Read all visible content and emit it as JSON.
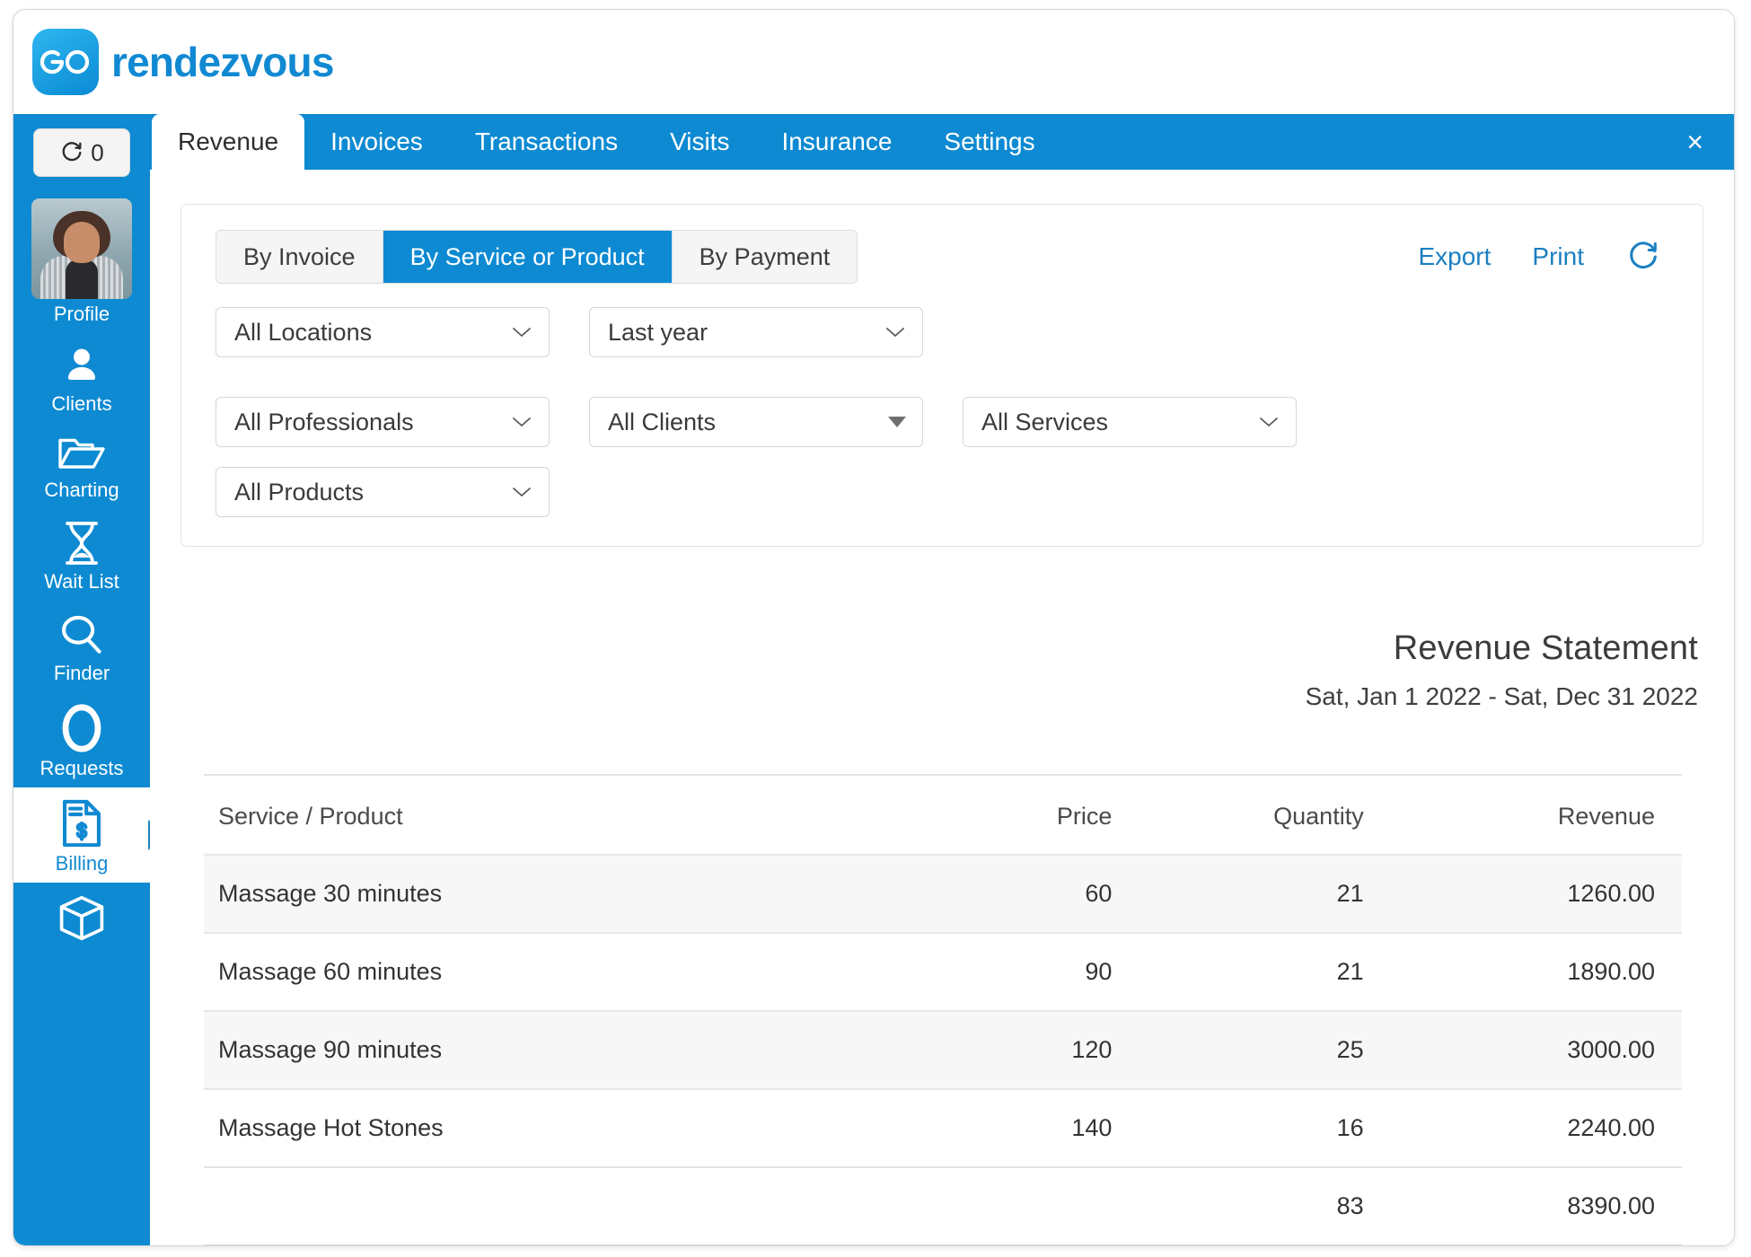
{
  "brand": {
    "logo_text": "GO",
    "name": "rendezvous",
    "logo_icon": "go-logo-icon",
    "accent_color": "#0d8ad2"
  },
  "sidebar": {
    "refresh": {
      "icon": "refresh-icon",
      "count": "0"
    },
    "items": [
      {
        "key": "profile",
        "label": "Profile",
        "icon": "avatar-photo",
        "active": false
      },
      {
        "key": "clients",
        "label": "Clients",
        "icon": "person-icon",
        "active": false
      },
      {
        "key": "charting",
        "label": "Charting",
        "icon": "folder-icon",
        "active": false
      },
      {
        "key": "waitlist",
        "label": "Wait List",
        "icon": "hourglass-icon",
        "active": false
      },
      {
        "key": "finder",
        "label": "Finder",
        "icon": "magnifier-icon",
        "active": false
      },
      {
        "key": "requests",
        "label": "Requests",
        "icon": "circle-icon",
        "active": false
      },
      {
        "key": "billing",
        "label": "Billing",
        "icon": "invoice-dollar-icon",
        "active": true
      },
      {
        "key": "inventory",
        "label": "",
        "icon": "box-cube-icon",
        "active": false
      }
    ]
  },
  "tabs": {
    "items": [
      {
        "label": "Revenue",
        "active": true
      },
      {
        "label": "Invoices",
        "active": false
      },
      {
        "label": "Transactions",
        "active": false
      },
      {
        "label": "Visits",
        "active": false
      },
      {
        "label": "Insurance",
        "active": false
      },
      {
        "label": "Settings",
        "active": false
      }
    ],
    "close_label": "×"
  },
  "toolbar": {
    "segments": [
      {
        "label": "By Invoice",
        "active": false
      },
      {
        "label": "By Service or Product",
        "active": true
      },
      {
        "label": "By Payment",
        "active": false
      }
    ],
    "export_label": "Export",
    "print_label": "Print",
    "refresh_icon": "refresh-icon"
  },
  "filters": [
    {
      "name": "locations",
      "value": "All Locations",
      "arrow": "chevron"
    },
    {
      "name": "period",
      "value": "Last year",
      "arrow": "chevron"
    },
    {
      "name": "professionals",
      "value": "All Professionals",
      "arrow": "chevron"
    },
    {
      "name": "clients",
      "value": "All Clients",
      "arrow": "triangle"
    },
    {
      "name": "services",
      "value": "All Services",
      "arrow": "chevron"
    },
    {
      "name": "products",
      "value": "All Products",
      "arrow": "chevron"
    }
  ],
  "statement": {
    "title": "Revenue Statement",
    "date_range": "Sat, Jan 1 2022 - Sat, Dec 31 2022"
  },
  "table": {
    "headers": {
      "name": "Service / Product",
      "price": "Price",
      "quantity": "Quantity",
      "revenue": "Revenue"
    },
    "rows": [
      {
        "name": "Massage 30 minutes",
        "price": "60",
        "quantity": "21",
        "revenue": "1260.00"
      },
      {
        "name": "Massage 60 minutes",
        "price": "90",
        "quantity": "21",
        "revenue": "1890.00"
      },
      {
        "name": "Massage 90 minutes",
        "price": "120",
        "quantity": "25",
        "revenue": "3000.00"
      },
      {
        "name": "Massage Hot Stones",
        "price": "140",
        "quantity": "16",
        "revenue": "2240.00"
      }
    ],
    "totals": {
      "name": "",
      "price": "",
      "quantity": "83",
      "revenue": "8390.00"
    }
  }
}
